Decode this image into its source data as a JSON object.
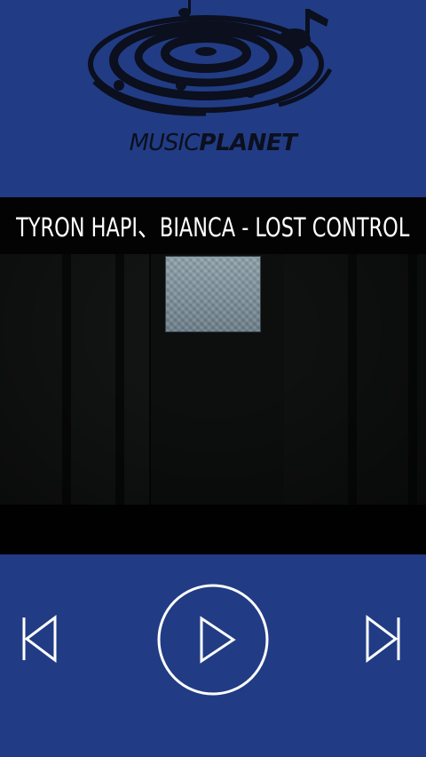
{
  "logo": {
    "word1": "MUSIC",
    "word2": "PLANET",
    "icon": "vinyl-record-music-note-icon"
  },
  "now_playing": {
    "title": "TYRON HAPI、BIANCA - LOST CONTROL"
  },
  "controls": {
    "previous_icon": "skip-previous-icon",
    "play_icon": "play-icon",
    "next_icon": "skip-next-icon"
  },
  "colors": {
    "background": "#213c84",
    "title_bar": "#030303",
    "icon_stroke": "#ffffff"
  }
}
